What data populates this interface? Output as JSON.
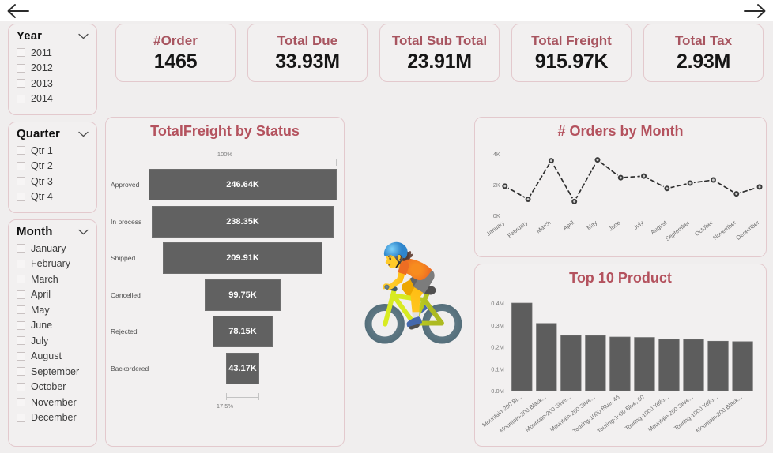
{
  "nav": {
    "back_label": "Back",
    "forward_label": "Forward",
    "back_icon": "arrow-left-icon",
    "forward_icon": "arrow-right-icon"
  },
  "theme": {
    "accent": "#b4525e",
    "kpi_title": "#a85560",
    "card_border": "#e3c9cd",
    "canvas_bg": "#f0eeee",
    "bar_fill": "#616161"
  },
  "slicers": [
    {
      "id": "year",
      "title": "Year",
      "chevron_icon": "chevron-down-icon",
      "items": [
        "2011",
        "2012",
        "2013",
        "2014"
      ]
    },
    {
      "id": "quarter",
      "title": "Quarter",
      "chevron_icon": "chevron-down-icon",
      "items": [
        "Qtr 1",
        "Qtr 2",
        "Qtr 3",
        "Qtr 4"
      ]
    },
    {
      "id": "month",
      "title": "Month",
      "chevron_icon": "chevron-down-icon",
      "items": [
        "January",
        "February",
        "March",
        "April",
        "May",
        "June",
        "July",
        "August",
        "September",
        "October",
        "November",
        "December"
      ]
    }
  ],
  "kpis": [
    {
      "title": "#Order",
      "value": "1465"
    },
    {
      "title": "Total Due",
      "value": "33.93M"
    },
    {
      "title": "Total Sub Total",
      "value": "23.91M"
    },
    {
      "title": "Total Freight",
      "value": "915.97K"
    },
    {
      "title": "Total Tax",
      "value": "2.93M"
    }
  ],
  "decoration": {
    "bicycle_icon": "cyclist-icon",
    "bicycle_glyph": "🚴"
  },
  "chart_data": [
    {
      "id": "funnel",
      "type": "bar",
      "title": "TotalFreight by Status",
      "xlabel": "",
      "ylabel": "",
      "top_percent_label": "100%",
      "bottom_percent_label": "17.5%",
      "categories": [
        "Approved",
        "In process",
        "Shipped",
        "Cancelled",
        "Rejected",
        "Backordered"
      ],
      "values": [
        246640,
        238350,
        209910,
        99750,
        78150,
        43170
      ],
      "value_labels": [
        "246.64K",
        "238.35K",
        "209.91K",
        "99.75K",
        "78.15K",
        "43.17K"
      ],
      "max_value": 246640
    },
    {
      "id": "orders-by-month",
      "type": "line",
      "title": "# Orders by Month",
      "xlabel": "",
      "ylabel": "",
      "categories": [
        "January",
        "February",
        "March",
        "April",
        "May",
        "June",
        "July",
        "August",
        "September",
        "October",
        "November",
        "December"
      ],
      "values": [
        1900,
        1050,
        3550,
        900,
        3600,
        2450,
        2550,
        1750,
        2100,
        2300,
        1400,
        1850
      ],
      "ylim": [
        0,
        4400
      ],
      "yticks": [
        0,
        2000,
        4000
      ],
      "ytick_labels": [
        "0K",
        "2K",
        "4K"
      ],
      "grid": false,
      "legend": "none"
    },
    {
      "id": "top-10-product",
      "type": "bar",
      "title": "Top 10 Product",
      "xlabel": "",
      "ylabel": "",
      "categories": [
        "Mountain-200 Bl...",
        "Mountain-200 Black...",
        "Mountain-200 Silve...",
        "Mountain-200 Silve...",
        "Touring-1000 Blue, 46",
        "Touring-1000 Blue, 60",
        "Touring-1000 Yello...",
        "Mountain-200 Silve...",
        "Touring-1000 Yello...",
        "Mountain-200 Black..."
      ],
      "values": [
        0.4,
        0.307,
        0.252,
        0.251,
        0.245,
        0.243,
        0.235,
        0.234,
        0.226,
        0.224
      ],
      "ylim": [
        0,
        0.44
      ],
      "yticks": [
        0,
        0.1,
        0.2,
        0.3,
        0.4
      ],
      "ytick_labels": [
        "0.0M",
        "0.1M",
        "0.2M",
        "0.3M",
        "0.4M"
      ],
      "grid": false,
      "legend": "none"
    }
  ]
}
